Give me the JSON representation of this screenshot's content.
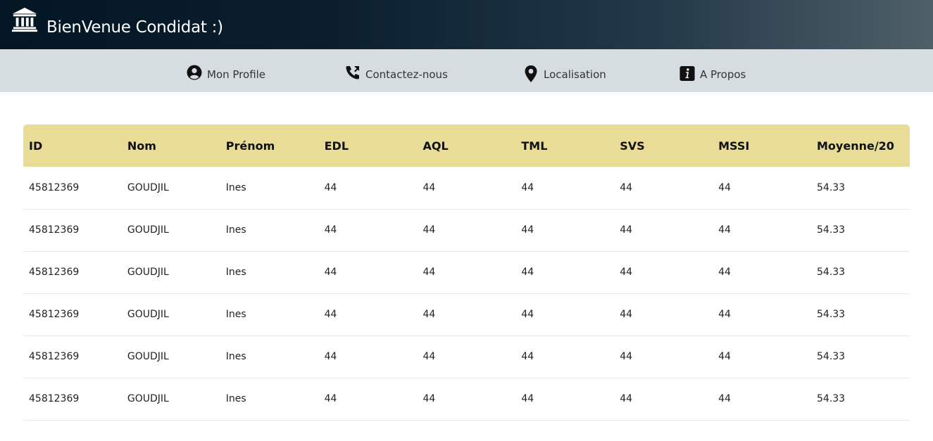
{
  "header": {
    "title": "BienVenue Condidat :)",
    "logo_icon": "bank-building-icon"
  },
  "nav": {
    "items": [
      {
        "label": "Mon Profile",
        "icon": "user-circle-icon"
      },
      {
        "label": "Contactez-nous",
        "icon": "phone-icon"
      },
      {
        "label": "Localisation",
        "icon": "map-pin-icon"
      },
      {
        "label": "A Propos",
        "icon": "info-icon"
      }
    ]
  },
  "table": {
    "columns": [
      "ID",
      "Nom",
      "Prénom",
      "EDL",
      "AQL",
      "TML",
      "SVS",
      "MSSI",
      "Moyenne/20"
    ],
    "rows": [
      [
        "45812369",
        "GOUDJIL",
        "Ines",
        "44",
        "44",
        "44",
        "44",
        "44",
        "54.33"
      ],
      [
        "45812369",
        "GOUDJIL",
        "Ines",
        "44",
        "44",
        "44",
        "44",
        "44",
        "54.33"
      ],
      [
        "45812369",
        "GOUDJIL",
        "Ines",
        "44",
        "44",
        "44",
        "44",
        "44",
        "54.33"
      ],
      [
        "45812369",
        "GOUDJIL",
        "Ines",
        "44",
        "44",
        "44",
        "44",
        "44",
        "54.33"
      ],
      [
        "45812369",
        "GOUDJIL",
        "Ines",
        "44",
        "44",
        "44",
        "44",
        "44",
        "54.33"
      ],
      [
        "45812369",
        "GOUDJIL",
        "Ines",
        "44",
        "44",
        "44",
        "44",
        "44",
        "54.33"
      ]
    ]
  },
  "colors": {
    "header_gradient_start": "#021624",
    "header_gradient_end": "#4e5f68",
    "navbar_bg": "#d6dde0",
    "table_header_bg": "#e8dc97"
  }
}
